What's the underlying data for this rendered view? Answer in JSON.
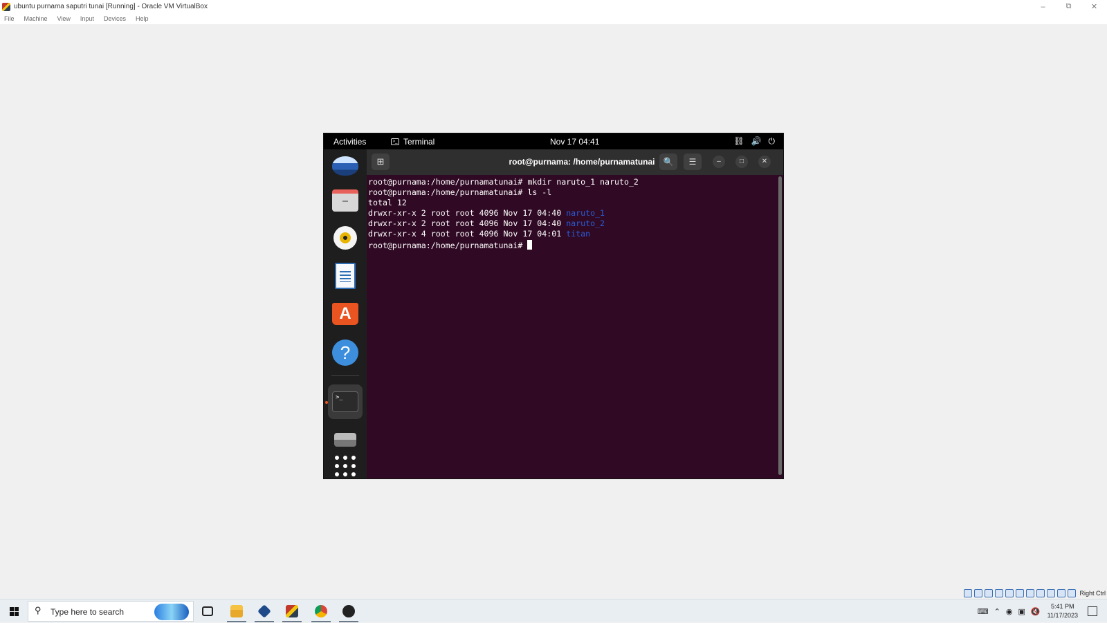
{
  "vbox": {
    "title": "ubuntu purnama saputri tunai [Running] - Oracle VM VirtualBox",
    "controls": {
      "minimize": "–",
      "restore": "⧉",
      "close": "✕"
    },
    "menu": [
      "File",
      "Machine",
      "View",
      "Input",
      "Devices",
      "Help"
    ],
    "host_key": "Right Ctrl"
  },
  "ubuntu": {
    "topbar": {
      "activities": "Activities",
      "app_name": "Terminal",
      "clock": "Nov 17  04:41",
      "tray_icons": [
        "network-icon",
        "volume-icon",
        "power-icon"
      ]
    },
    "dock": [
      "thunderbird-icon",
      "files-icon",
      "rhythmbox-icon",
      "writer-icon",
      "software-icon",
      "help-icon",
      "terminal-icon",
      "drive-icon",
      "apps-grid-icon"
    ]
  },
  "terminal": {
    "title": "root@purnama: /home/purnamatunai",
    "lines": [
      {
        "text": "root@purnama:/home/purnamatunai# mkdir naruto_1 naruto_2"
      },
      {
        "text": "root@purnama:/home/purnamatunai# ls -l"
      },
      {
        "text": "total 12"
      },
      {
        "prefix": "drwxr-xr-x 2 root root 4096 Nov 17 04:40 ",
        "dir": "naruto_1"
      },
      {
        "prefix": "drwxr-xr-x 2 root root 4096 Nov 17 04:40 ",
        "dir": "naruto_2"
      },
      {
        "prefix": "drwxr-xr-x 4 root root 4096 Nov 17 04:01 ",
        "dir": "titan"
      },
      {
        "text": "root@purnama:/home/purnamatunai# "
      }
    ],
    "dir_color": "#2a5bd7",
    "background": "#300a24"
  },
  "taskbar": {
    "search_placeholder": "Type here to search",
    "apps": [
      "task-view-icon",
      "file-explorer-icon",
      "virtualbox-icon",
      "sublime-icon",
      "chrome-icon",
      "obs-icon"
    ],
    "time": "5:41 PM",
    "date": "11/17/2023"
  }
}
